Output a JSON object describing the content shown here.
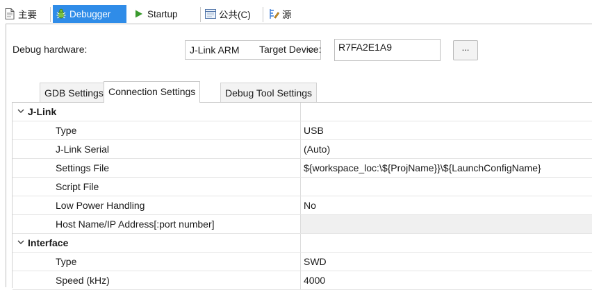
{
  "top_tabs": [
    {
      "label": "主要",
      "icon": "document-icon",
      "active": false
    },
    {
      "label": "Debugger",
      "icon": "bug-icon",
      "active": true
    },
    {
      "label": "Startup",
      "icon": "play-icon",
      "active": false
    },
    {
      "label": "公共(C)",
      "icon": "window-icon",
      "active": false
    },
    {
      "label": "源",
      "icon": "source-lookup-icon",
      "active": false
    }
  ],
  "debugger": {
    "hardware_label": "Debug hardware:",
    "hardware_value": "J-Link ARM",
    "target_label": "Target Device:",
    "target_value": "R7FA2E1A9",
    "browse_label": "..."
  },
  "inner_tabs": [
    {
      "label": "GDB Settings",
      "active": false
    },
    {
      "label": "Connection Settings",
      "active": true
    },
    {
      "label": "Debug Tool Settings",
      "active": false
    }
  ],
  "tree": {
    "jlink": {
      "label": "J-Link",
      "rows": [
        {
          "name": "Type",
          "value": "USB"
        },
        {
          "name": "J-Link Serial",
          "value": "(Auto)"
        },
        {
          "name": "Settings File",
          "value": "${workspace_loc:\\${ProjName}}\\${LaunchConfigName}"
        },
        {
          "name": "Script File",
          "value": ""
        },
        {
          "name": "Low Power Handling",
          "value": "No"
        },
        {
          "name": "Host Name/IP Address[:port number]",
          "value": ""
        }
      ]
    },
    "interface": {
      "label": "Interface",
      "rows": [
        {
          "name": "Type",
          "value": "SWD"
        },
        {
          "name": "Speed (kHz)",
          "value": "4000"
        }
      ]
    }
  },
  "colors": {
    "active_tab": "#2f8ce8",
    "bug_icon": "#7ac142",
    "play_icon": "#3a9a2e"
  }
}
